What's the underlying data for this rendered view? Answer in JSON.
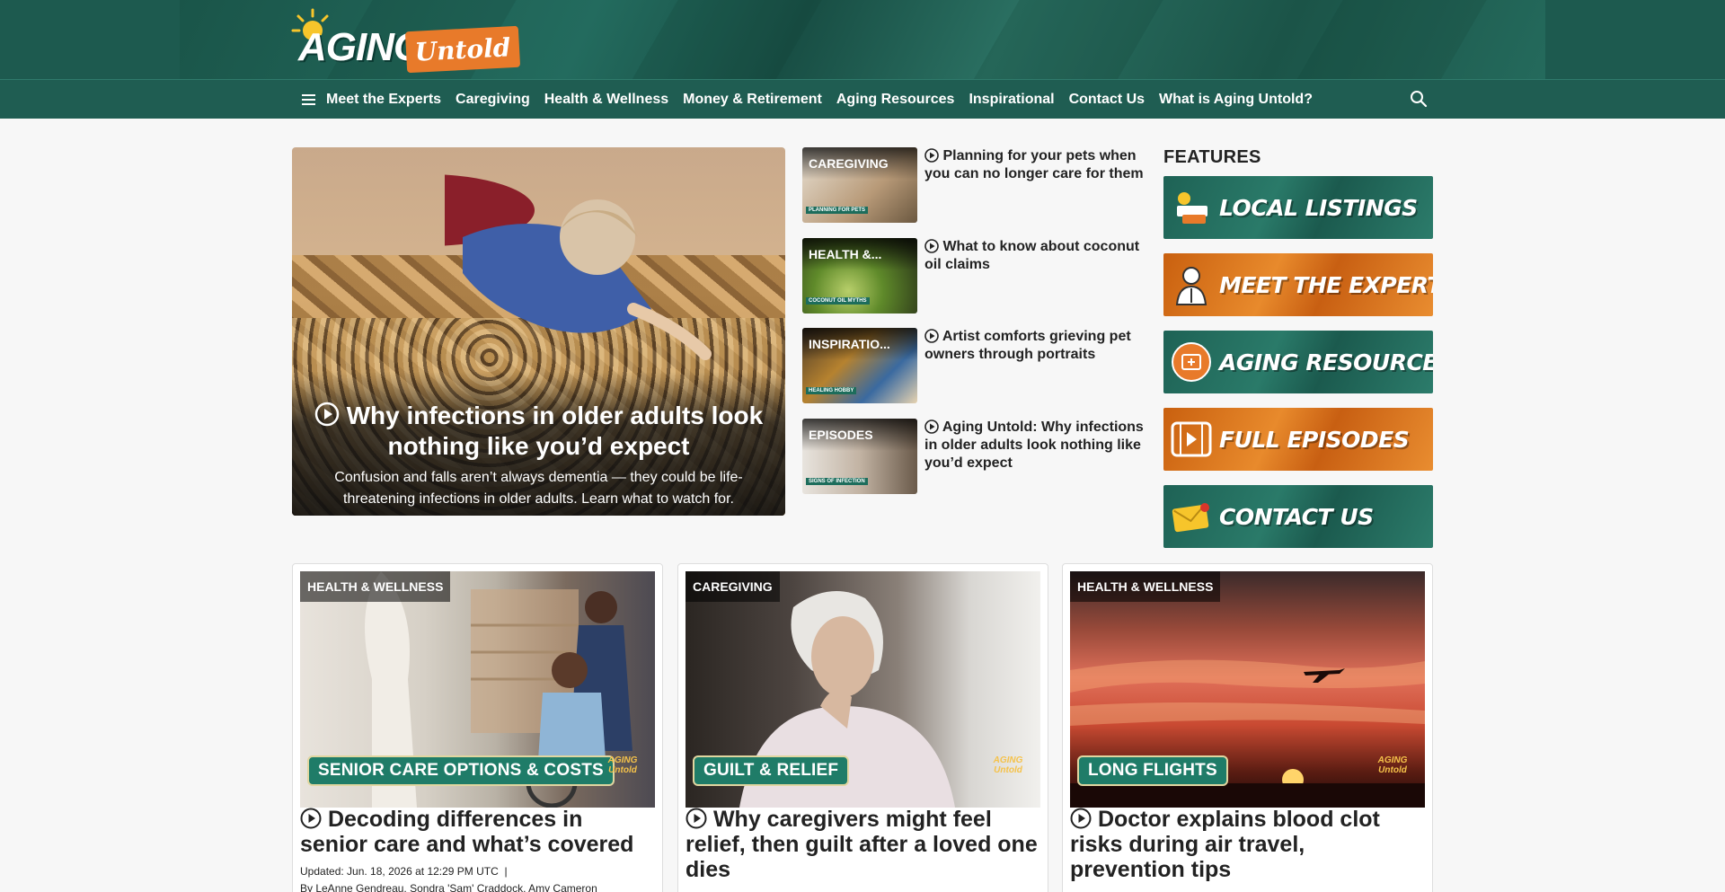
{
  "header": {
    "logo": {
      "word1": "AGING",
      "word2": "Untold"
    }
  },
  "nav": {
    "items": [
      "Meet the Experts",
      "Caregiving",
      "Health & Wellness",
      "Money & Retirement",
      "Aging Resources",
      "Inspirational",
      "Contact Us",
      "What is Aging Untold?"
    ]
  },
  "hero": {
    "title": "Why infections in older adults look nothing like you’d expect",
    "subtitle": "Confusion and falls aren’t always dementia — they could be life-threatening infections in older adults. Learn what to watch for."
  },
  "side_stories": [
    {
      "category": "CAREGIVING",
      "tag": "PLANNING FOR PETS",
      "title": "Planning for your pets when you can no longer care for them"
    },
    {
      "category": "HEALTH &...",
      "tag": "COCONUT OIL MYTHS",
      "title": "What to know about coconut oil claims"
    },
    {
      "category": "INSPIRATIO...",
      "tag": "HEALING HOBBY",
      "title": "Artist comforts grieving pet owners through portraits"
    },
    {
      "category": "EPISODES",
      "tag": "SIGNS OF INFECTION",
      "title": "Aging Untold: Why infections in older adults look nothing like you’d expect"
    }
  ],
  "features": {
    "heading": "FEATURES",
    "items": [
      {
        "label": "LOCAL LISTINGS",
        "icon": "aging-untold-logo-icon",
        "color": "green"
      },
      {
        "label": "MEET THE EXPERTS",
        "icon": "expert-person-icon",
        "color": "orange"
      },
      {
        "label": "AGING RESOURCES",
        "icon": "resource-box-icon",
        "color": "green"
      },
      {
        "label": "FULL EPISODES",
        "icon": "film-play-icon",
        "color": "orange"
      },
      {
        "label": "CONTACT US",
        "icon": "envelope-icon",
        "color": "green"
      }
    ]
  },
  "cards": [
    {
      "category": "HEALTH & WELLNESS",
      "badge": "SENIOR CARE OPTIONS & COSTS",
      "title": "Decoding differences in senior care and what’s covered",
      "updated": "Updated: Jun. 18, 2026 at 12:29 PM UTC",
      "byline": "By LeAnne Gendreau, Sondra 'Sam' Craddock, Amy Cameron"
    },
    {
      "category": "CAREGIVING",
      "badge": "GUILT & RELIEF",
      "title": "Why caregivers might feel relief, then guilt after a loved one dies"
    },
    {
      "category": "HEALTH & WELLNESS",
      "badge": "LONG FLIGHTS",
      "title": "Doctor explains blood clot risks during air travel, prevention tips"
    }
  ],
  "watermark": {
    "line1": "AGING",
    "line2": "Untold"
  },
  "colors": {
    "brand_green": "#1f5d52",
    "brand_orange": "#e87a2a",
    "badge_green": "#1f7c68"
  }
}
